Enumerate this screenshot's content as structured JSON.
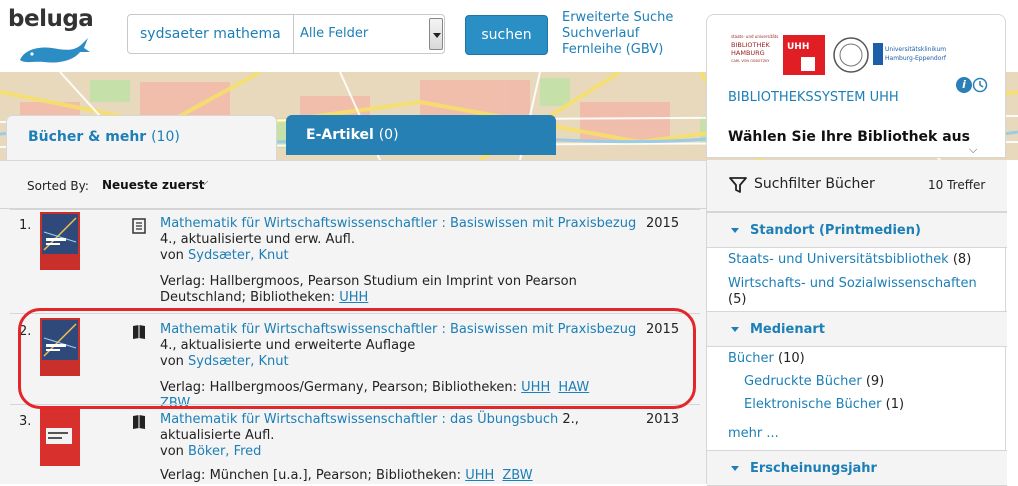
{
  "header": {
    "logo_text": "beluga",
    "search_value": "sydsaeter mathema",
    "field_select": "Alle Felder",
    "search_button": "suchen",
    "links": [
      "Erweiterte Suche",
      "Suchverlauf",
      "Fernleihe (GBV)"
    ]
  },
  "tabs": [
    {
      "label": "Bücher & mehr",
      "count": "(10)",
      "active": true
    },
    {
      "label": "E-Artikel",
      "count": "(0)",
      "active": false
    }
  ],
  "sort": {
    "label": "Sorted By:",
    "value": "Neueste zuerst"
  },
  "results": [
    {
      "num": "1.",
      "title": "Mathematik für Wirtschaftswissenschaftler : Basiswissen mit Praxisbezug",
      "edition": "4., aktualisierte und erw. Aufl.",
      "author_prefix": "von",
      "author": "Sydsæter, Knut",
      "year": "2015",
      "publisher": "Verlag: Hallbergmoos, Pearson Studium ein Imprint von Pearson Deutschland; Bibliotheken:",
      "libraries": [
        "UHH"
      ]
    },
    {
      "num": "2.",
      "title": "Mathematik für Wirtschaftswissenschaftler : Basiswissen mit Praxisbezug",
      "edition": "4., aktualisierte und erweiterte Auflage",
      "author_prefix": "von",
      "author": "Sydsæter, Knut",
      "year": "2015",
      "publisher": "Verlag: Hallbergmoos/Germany, Pearson; Bibliotheken:",
      "libraries": [
        "UHH",
        "HAW",
        "ZBW"
      ]
    },
    {
      "num": "3.",
      "title": "Mathematik für Wirtschaftswissenschaftler : das Übungsbuch",
      "edition": "2., aktualisierte Aufl.",
      "author_prefix": "von",
      "author": "Böker, Fred",
      "year": "2013",
      "publisher": "Verlag: München [u.a.], Pearson; Bibliotheken:",
      "libraries": [
        "UHH",
        "ZBW"
      ]
    }
  ],
  "library": {
    "logo_texts": [
      "staats- und universitäts",
      "BIBLIOTHEK",
      "HAMBURG",
      "CARL VON OSSIETZKY",
      "UHH",
      "Universitätsklinikum",
      "Hamburg-Eppendorf"
    ],
    "info_icon": "i",
    "name": "BIBLIOTHEKSSYSTEM UHH",
    "choose": "Wählen Sie Ihre Bibliothek aus"
  },
  "facets": {
    "title": "Suchfilter Bücher",
    "count": "10 Treffer",
    "groups": [
      {
        "name": "Standort (Printmedien)",
        "items": [
          {
            "label": "Staats- und Universitätsbibliothek",
            "count": "(8)"
          },
          {
            "label": "Wirtschafts- und Sozialwissenschaften",
            "count": "(5)"
          }
        ]
      },
      {
        "name": "Medienart",
        "items": [
          {
            "label": "Bücher",
            "count": "(10)"
          },
          {
            "label": "Gedruckte Bücher",
            "count": "(9)"
          },
          {
            "label": "Elektronische Bücher",
            "count": "(1)"
          }
        ],
        "more": "mehr ..."
      },
      {
        "name": "Erscheinungsjahr",
        "items": []
      }
    ]
  },
  "colors": {
    "accent": "#1c7fb6",
    "tab_active_bg": "#2680b4",
    "highlight": "#e3262a"
  }
}
